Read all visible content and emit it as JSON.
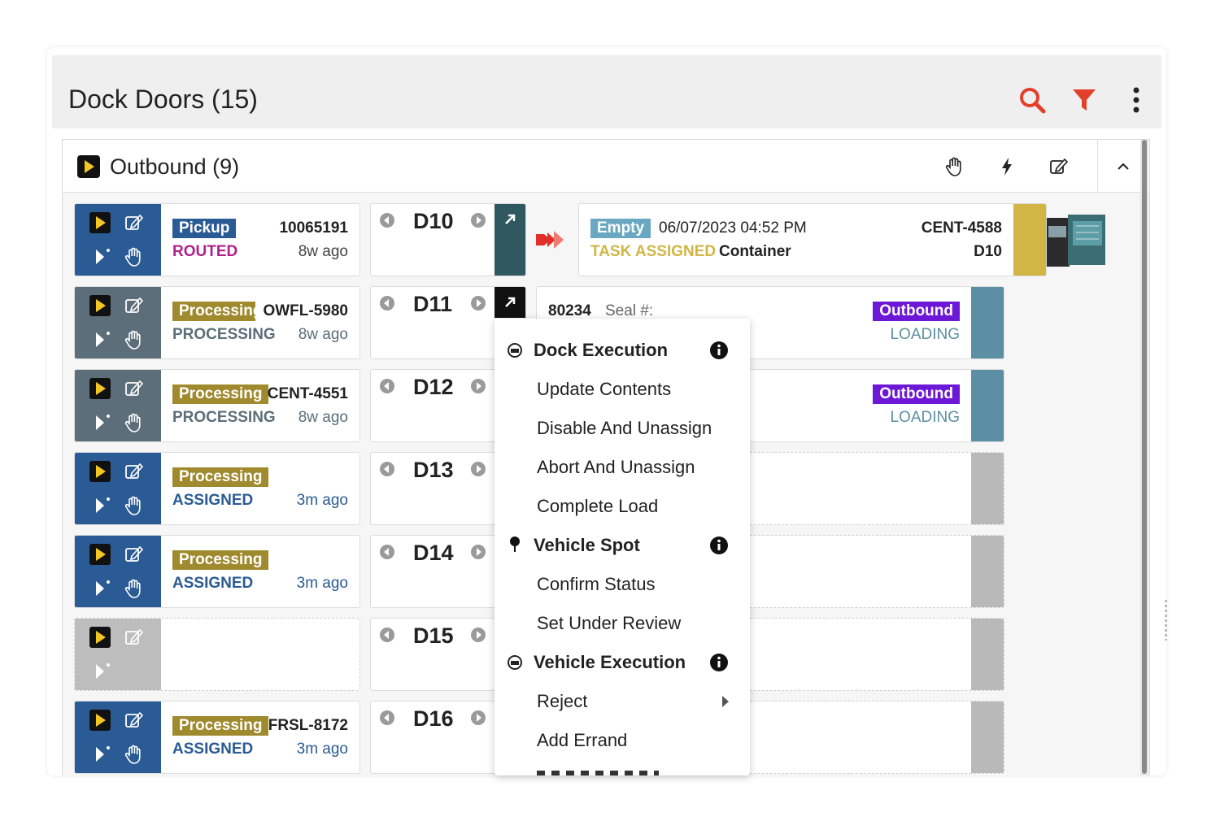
{
  "header": {
    "title": "Dock Doors (15)"
  },
  "icons": {
    "search": "search-icon",
    "filter": "filter-icon",
    "more": "more-vertical-icon"
  },
  "panel": {
    "title": "Outbound (9)"
  },
  "colors": {
    "accent": "#e1412b",
    "blue": "#2a5b94",
    "slate": "#5c6e79",
    "gold": "#a08a2e",
    "magenta": "#b0208a",
    "purple": "#6d18d6",
    "teal": "#5c8fa3",
    "empty_badge": "#6aa8c2",
    "yellow_tab": "#d1b645"
  },
  "rows": [
    {
      "badge": "Pickup",
      "code": "10065191",
      "status": "ROUTED",
      "age": "8w ago",
      "door": "D10"
    },
    {
      "badge": "Processing",
      "code": "OWFL-5980",
      "status": "PROCESSING",
      "age": "8w ago",
      "door": "D11",
      "seal_num": "80234",
      "seal_label": "Seal #:",
      "info_badge": "Outbound",
      "info_status": "LOADING"
    },
    {
      "badge": "Processing",
      "code": "CENT-4551",
      "status": "PROCESSING",
      "age": "8w ago",
      "door": "D12",
      "info_badge": "Outbound",
      "info_status": "LOADING"
    },
    {
      "badge": "Processing",
      "code": "",
      "status": "ASSIGNED",
      "age": "3m ago",
      "door": "D13"
    },
    {
      "badge": "Processing",
      "code": "",
      "status": "ASSIGNED",
      "age": "3m ago",
      "door": "D14"
    },
    {
      "badge": "",
      "code": "",
      "status": "",
      "age": "",
      "door": "D15"
    },
    {
      "badge": "Processing",
      "code": "FRSL-8172",
      "status": "ASSIGNED",
      "age": "3m ago",
      "door": "D16"
    }
  ],
  "trailer": {
    "badge": "Empty",
    "datetime": "06/07/2023 04:52 PM",
    "status": "TASK ASSIGNED",
    "type": "Container",
    "id": "CENT-4588",
    "door": "D10"
  },
  "menu": {
    "items": [
      {
        "label": "Dock Execution",
        "group": true
      },
      {
        "label": "Update Contents",
        "group": false
      },
      {
        "label": "Disable And Unassign",
        "group": false
      },
      {
        "label": "Abort And Unassign",
        "group": false
      },
      {
        "label": "Complete Load",
        "group": false
      },
      {
        "label": "Vehicle Spot",
        "group": true
      },
      {
        "label": "Confirm Status",
        "group": false
      },
      {
        "label": "Set Under Review",
        "group": false
      },
      {
        "label": "Vehicle Execution",
        "group": true
      },
      {
        "label": "Reject",
        "group": false
      },
      {
        "label": "Add Errand",
        "group": false
      }
    ]
  }
}
